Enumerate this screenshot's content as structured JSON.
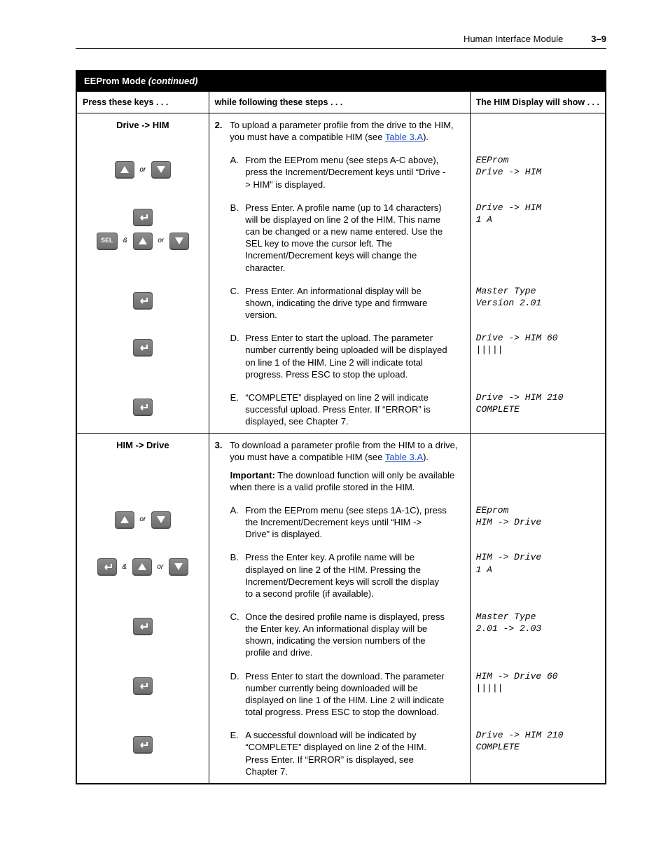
{
  "header": {
    "title": "Human Interface Module",
    "page": "3–9"
  },
  "band": {
    "title": "EEProm Mode",
    "continued": "(continued)"
  },
  "columns": {
    "keys": "Press these keys . . .",
    "steps": "while following these steps . . .",
    "display": "The HIM Display will show . . ."
  },
  "conj": {
    "or": "or",
    "and": "&"
  },
  "icons": {
    "up": "up-triangle-icon",
    "down": "down-triangle-icon",
    "enter": "enter-icon",
    "sel": "SEL",
    "left": "left-arrow-icon"
  },
  "section2": {
    "keysTitle": "Drive -> HIM",
    "num": "2.",
    "intro_a": "To upload a parameter profile from the drive to the HIM, you must have a compatible HIM (see ",
    "intro_link": "Table 3.A",
    "intro_b": ").",
    "A": {
      "ltr": "A.",
      "txt": "From the EEProm menu (see steps A-C above), press the Increment/Decrement keys until “Drive -> HIM” is displayed.",
      "disp": "EEProm\nDrive -> HIM"
    },
    "B": {
      "ltr": "B.",
      "txt": "Press Enter. A profile name (up to 14 characters) will be displayed on line 2 of the HIM. This name can be changed or a new name entered. Use the SEL key to move the cursor left. The Increment/Decrement keys will change the character.",
      "disp": "Drive -> HIM\n1 A"
    },
    "C": {
      "ltr": "C.",
      "txt": "Press Enter. An informational display will be shown, indicating the drive type and firmware version.",
      "disp": "Master Type\nVersion 2.01"
    },
    "D": {
      "ltr": "D.",
      "txt": "Press Enter to start the upload. The parameter number currently being uploaded will be displayed on line 1 of the HIM. Line 2 will indicate total progress. Press ESC to stop the upload.",
      "disp": "Drive -> HIM 60\n|||||"
    },
    "E": {
      "ltr": "E.",
      "txt": "“COMPLETE” displayed on line 2 will indicate successful upload. Press Enter. If “ERROR” is displayed, see Chapter 7.",
      "disp": "Drive -> HIM 210\nCOMPLETE"
    }
  },
  "section3": {
    "keysTitle": "HIM -> Drive",
    "num": "3.",
    "intro_a": "To download a parameter profile from the HIM to a drive, you must have a compatible HIM (see ",
    "intro_link": "Table 3.A",
    "intro_b": ").",
    "important_label": "Important:",
    "important_txt": " The download function will only be available when there is a valid profile stored in the HIM.",
    "A": {
      "ltr": "A.",
      "txt": "From the EEProm menu (see steps 1A-1C), press the Increment/Decrement keys until “HIM -> Drive” is displayed.",
      "disp": "EEprom\nHIM -> Drive"
    },
    "B": {
      "ltr": "B.",
      "txt": "Press the Enter key. A profile name will be displayed on line 2 of the HIM. Pressing the Increment/Decrement keys will scroll the display to a second profile (if available).",
      "disp": "HIM -> Drive\n1 A"
    },
    "C": {
      "ltr": "C.",
      "txt": "Once the desired profile name is displayed, press the Enter key. An informational display will be shown, indicating the version numbers of the profile and drive.",
      "disp": "Master Type\n2.01 -> 2.03"
    },
    "D": {
      "ltr": "D.",
      "txt": "Press Enter to start the download. The parameter number currently being downloaded will be displayed on line 1 of the HIM. Line 2 will indicate total progress. Press ESC to stop the download.",
      "disp": "HIM -> Drive 60\n|||||"
    },
    "E": {
      "ltr": "E.",
      "txt": "A successful download will be indicated by “COMPLETE” displayed on line 2 of the HIM. Press Enter. If “ERROR” is displayed, see Chapter 7.",
      "disp": "Drive -> HIM 210\nCOMPLETE"
    }
  }
}
